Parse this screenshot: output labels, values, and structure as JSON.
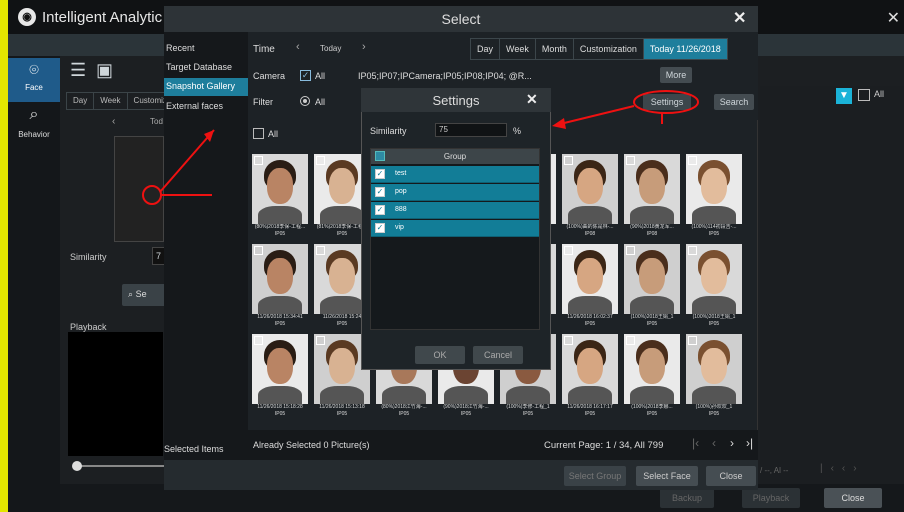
{
  "app": {
    "title": "Intelligent Analytic"
  },
  "left_nav": {
    "face": "Face",
    "behavior": "Behavior"
  },
  "bg": {
    "tabs": [
      "Day",
      "Week",
      "Customiz"
    ],
    "partial_today": "Tod",
    "similarity_label": "Similarity",
    "similarity_partial": "7",
    "search_partial": "Se",
    "playback_label": "Playback",
    "filter_all": "All",
    "bottom_page": "/ --, Al --",
    "backup": "Backup",
    "playback": "Playback",
    "close": "Close"
  },
  "select": {
    "title": "Select",
    "sidebar": [
      "Recent",
      "Target Database",
      "Snapshot Gallery",
      "External faces"
    ],
    "selected_items": "Selected Items",
    "time_label": "Time",
    "today_nav": "Today",
    "time_tabs": [
      "Day",
      "Week",
      "Month",
      "Customization",
      "Today 11/26/2018"
    ],
    "camera_label": "Camera",
    "camera_all": "All",
    "camera_list": "IP05;IP07;IPCamera;IP05;IP08;IP04;  @R...",
    "more": "More",
    "filter_label": "Filter",
    "filter_all": "All",
    "settings": "Settings",
    "search": "Search",
    "grid_all": "All",
    "faces": [
      {
        "cap": "(80%)2018李保-工程...",
        "cam": "IP05",
        "checked": false
      },
      {
        "cap": "(81%)2018李保-工程...",
        "cam": "IP05",
        "checked": false
      },
      {
        "cap": "",
        "cam": "",
        "checked": false
      },
      {
        "cap": "",
        "cam": "",
        "checked": false
      },
      {
        "cap": "",
        "cam": "",
        "checked": false
      },
      {
        "cap": "(100%)曲的陈是林-...",
        "cam": "IP08",
        "checked": false
      },
      {
        "cap": "(90%)2018黄龙军...",
        "cam": "IP08",
        "checked": false
      },
      {
        "cap": "(100%)114初段吉-...",
        "cam": "IP05",
        "checked": false
      },
      {
        "cap": "11/26/2018 15:34:41",
        "cam": "IP05",
        "checked": false
      },
      {
        "cap": "11/26/2018 15:24",
        "cam": "IP05",
        "checked": false
      },
      {
        "cap": "",
        "cam": "",
        "checked": false
      },
      {
        "cap": "",
        "cam": "",
        "checked": false
      },
      {
        "cap": "",
        "cam": "",
        "checked": false
      },
      {
        "cap": "11/26/2018 16:02:37",
        "cam": "IP05",
        "checked": false
      },
      {
        "cap": "(100%)2018王娟_1",
        "cam": "IP05",
        "checked": false
      },
      {
        "cap": "(100%)2018王娟_1",
        "cam": "IP05",
        "checked": false
      },
      {
        "cap": "11/26/2018 15:18:28",
        "cam": "IP05",
        "checked": false
      },
      {
        "cap": "11/26/2018 15:13:18",
        "cam": "IP05",
        "checked": false
      },
      {
        "cap": "(80%)2018江竹海-...",
        "cam": "IP05",
        "checked": false
      },
      {
        "cap": "(90%)2018江竹海-...",
        "cam": "IP05",
        "checked": false
      },
      {
        "cap": "(100%)李修-工程_1",
        "cam": "IP05",
        "checked": false
      },
      {
        "cap": "11/26/2018 16:17:17",
        "cam": "IP05",
        "checked": false
      },
      {
        "cap": "(100%)2018李娜...",
        "cam": "IP05",
        "checked": false
      },
      {
        "cap": "(100%)孙欢欢_1",
        "cam": "IP05",
        "checked": false
      }
    ],
    "already_selected": "Already Selected 0 Picture(s)",
    "current_page": "Current Page: 1 / 34, All 799",
    "select_group": "Select Group",
    "select_face": "Select Face",
    "close": "Close"
  },
  "settings": {
    "title": "Settings",
    "similarity_label": "Similarity",
    "similarity_value": "75",
    "percent": "%",
    "group_header": "Group",
    "groups": [
      "test",
      "pop",
      "888",
      "vip"
    ],
    "ok": "OK",
    "cancel": "Cancel"
  }
}
